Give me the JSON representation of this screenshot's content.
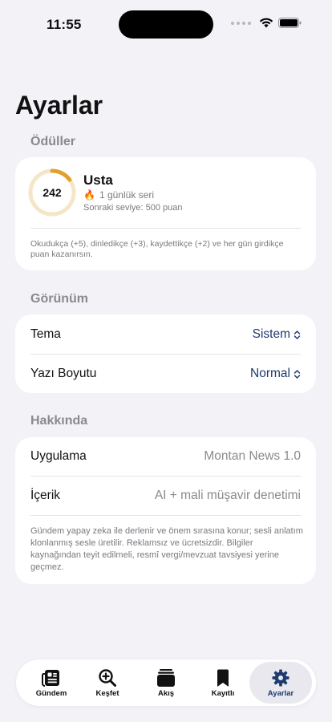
{
  "status_bar": {
    "time": "11:55"
  },
  "page": {
    "title": "Ayarlar"
  },
  "rewards": {
    "header": "Ödüller",
    "points": "242",
    "progress": 0.15,
    "level": "Usta",
    "streak_icon": "🔥",
    "streak": "1 günlük seri",
    "next_level": "Sonraki seviye: 500 puan",
    "description": "Okudukça (+5), dinledikçe (+3), kaydettikçe (+2) ve her gün girdikçe puan kazanırsın.",
    "accent_color": "#e0a030"
  },
  "appearance": {
    "header": "Görünüm",
    "theme_label": "Tema",
    "theme_value": "Sistem",
    "font_size_label": "Yazı Boyutu",
    "font_size_value": "Normal"
  },
  "about": {
    "header": "Hakkında",
    "app_label": "Uygulama",
    "app_value": "Montan News 1.0",
    "content_label": "İçerik",
    "content_value": "AI + mali müşavir denetimi",
    "description": "Gündem yapay zeka ile derlenir ve önem sırasına konur; sesli anlatım klonlanmış sesle üretilir. Reklamsız ve ücretsizdir. Bilgiler kaynağından teyit edilmeli, resmî vergi/mevzuat tavsiyesi yerine geçmez."
  },
  "tabs": [
    {
      "label": "Gündem",
      "icon": "newspaper-icon"
    },
    {
      "label": "Keşfet",
      "icon": "magnifier-plus-icon"
    },
    {
      "label": "Akış",
      "icon": "stack-icon"
    },
    {
      "label": "Kayıtlı",
      "icon": "bookmark-icon"
    },
    {
      "label": "Ayarlar",
      "icon": "gear-icon",
      "active": true
    }
  ],
  "colors": {
    "accent": "#1e3a6e",
    "background": "#f2f2f7"
  }
}
